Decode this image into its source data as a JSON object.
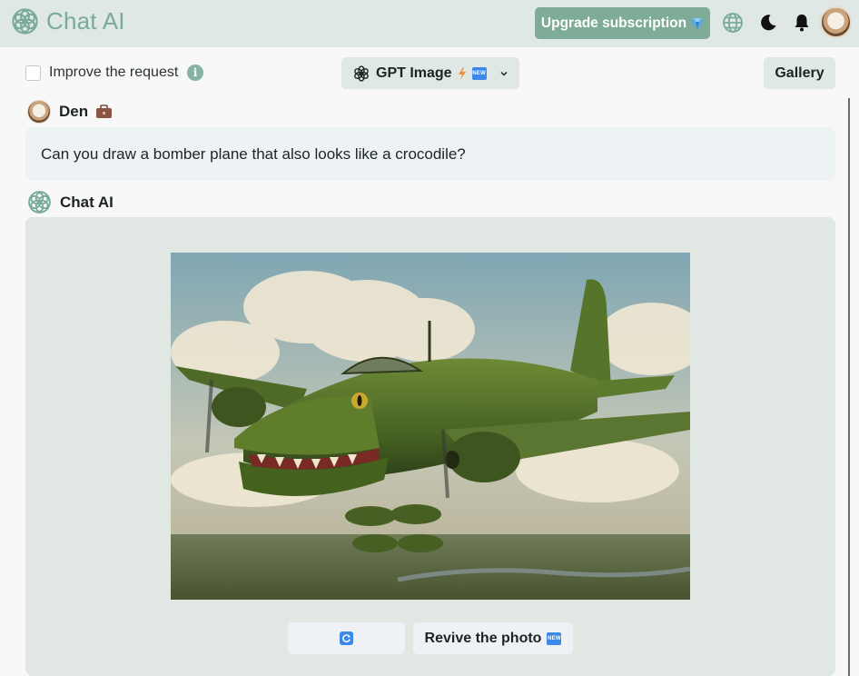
{
  "header": {
    "brand": "Chat AI",
    "upgrade_label": "Upgrade subscription",
    "icons": [
      "globe-icon",
      "moon-icon",
      "bell-icon",
      "avatar"
    ]
  },
  "toolbar": {
    "improve_label": "Improve the request",
    "info_glyph": "i",
    "model_name": "GPT Image",
    "new_badge": "NEW",
    "gallery_label": "Gallery"
  },
  "chat": {
    "user_name": "Den",
    "user_message": "Can you draw a bomber plane that also looks like a crocodile?",
    "bot_name": "Chat AI",
    "revive_label": "Revive the photo",
    "revive_badge": "NEW"
  },
  "colors": {
    "accent": "#7fac98",
    "header_bg": "#dfe8e4",
    "bot_bubble": "#e1e8e4",
    "user_bubble": "#edf2f5",
    "new_badge": "#3b88e8"
  }
}
